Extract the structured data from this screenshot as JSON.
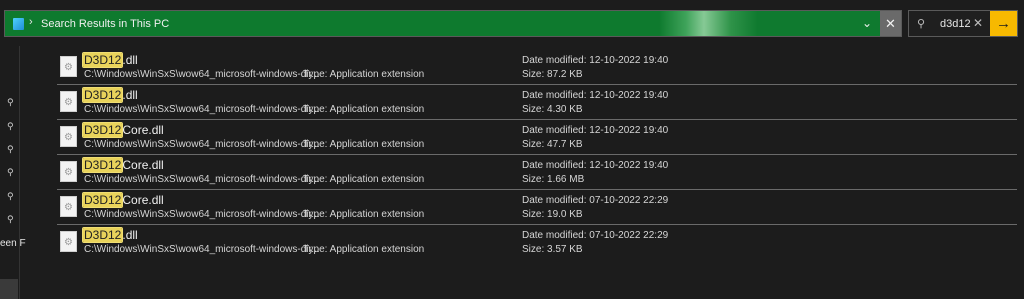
{
  "address_bar": {
    "crumb": "Search Results in This PC",
    "dropdown_icon": "chevron-down-icon",
    "clear_icon": "close-icon"
  },
  "search": {
    "query": "d3d12",
    "clear_icon": "close-icon",
    "go_icon": "arrow-right-icon",
    "accent": "#f7b900"
  },
  "left_pane": {
    "truncated_label": "een F"
  },
  "results": [
    {
      "name_highlight": "D3D12",
      "name_rest": ".dll",
      "path": "C:\\Windows\\WinSxS\\wow64_microsoft-windows-dir...",
      "type": "Type: Application extension",
      "modified": "Date modified: 12-10-2022 19:40",
      "size": "Size: 87.2 KB"
    },
    {
      "name_highlight": "D3D12",
      "name_rest": ".dll",
      "path": "C:\\Windows\\WinSxS\\wow64_microsoft-windows-dir...",
      "type": "Type: Application extension",
      "modified": "Date modified: 12-10-2022 19:40",
      "size": "Size: 4.30 KB"
    },
    {
      "name_highlight": "D3D12",
      "name_rest": "Core.dll",
      "path": "C:\\Windows\\WinSxS\\wow64_microsoft-windows-dir...",
      "type": "Type: Application extension",
      "modified": "Date modified: 12-10-2022 19:40",
      "size": "Size: 47.7 KB"
    },
    {
      "name_highlight": "D3D12",
      "name_rest": "Core.dll",
      "path": "C:\\Windows\\WinSxS\\wow64_microsoft-windows-dir...",
      "type": "Type: Application extension",
      "modified": "Date modified: 12-10-2022 19:40",
      "size": "Size: 1.66 MB"
    },
    {
      "name_highlight": "D3D12",
      "name_rest": "Core.dll",
      "path": "C:\\Windows\\WinSxS\\wow64_microsoft-windows-dir...",
      "type": "Type: Application extension",
      "modified": "Date modified: 07-10-2022 22:29",
      "size": "Size: 19.0 KB"
    },
    {
      "name_highlight": "D3D12",
      "name_rest": ".dll",
      "path": "C:\\Windows\\WinSxS\\wow64_microsoft-windows-dir...",
      "type": "Type: Application extension",
      "modified": "Date modified: 07-10-2022 22:29",
      "size": "Size: 3.57 KB"
    }
  ]
}
